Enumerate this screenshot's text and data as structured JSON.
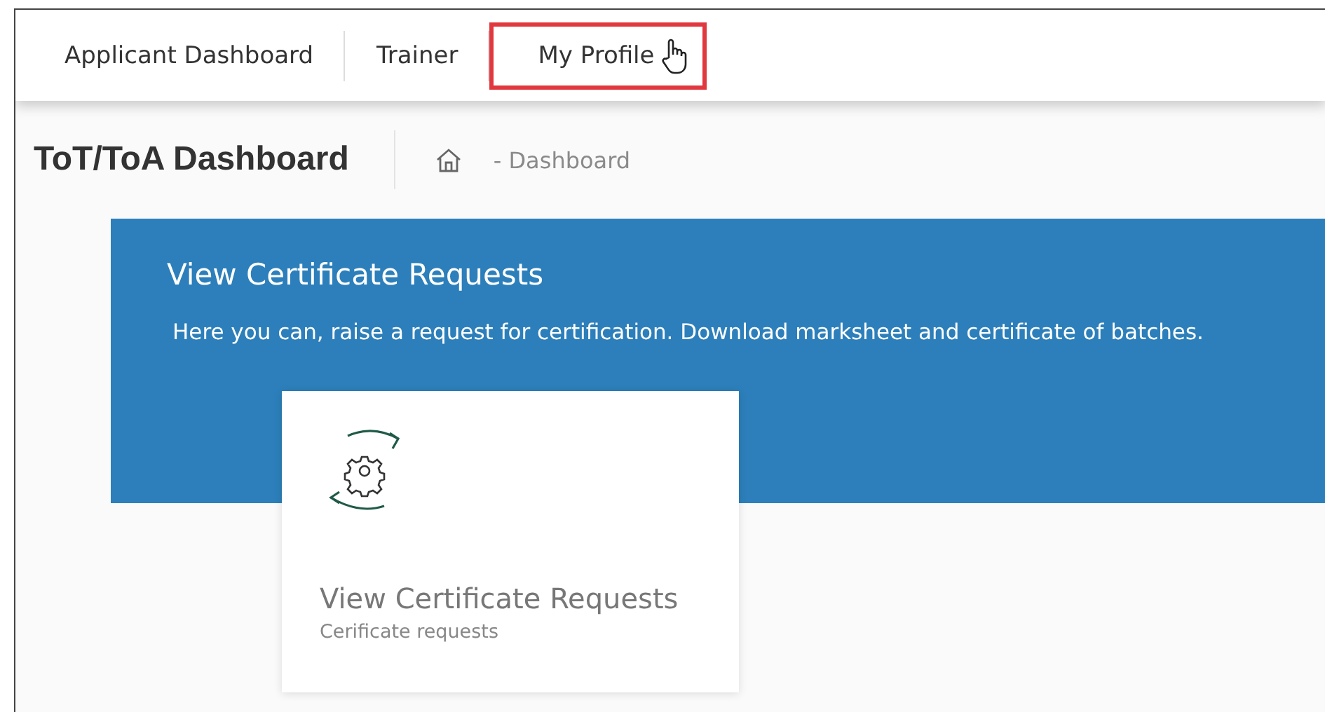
{
  "nav": {
    "items": [
      {
        "label": "Applicant Dashboard",
        "highlighted": false
      },
      {
        "label": "Trainer",
        "highlighted": false
      },
      {
        "label": "My Profile",
        "highlighted": true
      }
    ]
  },
  "header": {
    "title": "ToT/ToA Dashboard",
    "breadcrumb": "- Dashboard"
  },
  "banner": {
    "title": "View Certificate Requests",
    "description": "Here you can, raise a request for certification. Download marksheet and certificate of batches."
  },
  "cards": [
    {
      "title": "View Certificate Requests",
      "subtitle": "Cerificate requests"
    }
  ]
}
